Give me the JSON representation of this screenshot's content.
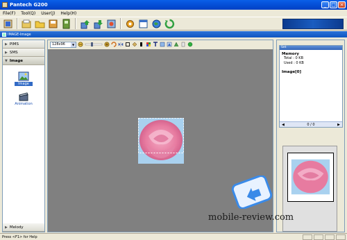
{
  "window": {
    "title": "Pantech G200"
  },
  "window_controls": [
    "minimize-icon",
    "maximize-icon",
    "close-icon"
  ],
  "menu": [
    {
      "label": "File(F)"
    },
    {
      "label": "Tool(Q)"
    },
    {
      "label": "User(J)"
    },
    {
      "label": "Help(H)"
    }
  ],
  "toolbar_icons": [
    "connect-icon",
    "folder-open-icon",
    "folder-icon",
    "save-icon",
    "phonebook-icon",
    "upload-icon",
    "download-icon",
    "sync-icon",
    "settings-icon",
    "calendar-icon",
    "globe-icon",
    "refresh-icon"
  ],
  "pathbar": {
    "label": "IMAGE-Image"
  },
  "sidebar": {
    "sections": [
      {
        "label": "PIMS"
      },
      {
        "label": "SMS"
      },
      {
        "label": "Image"
      }
    ],
    "items": [
      {
        "label": "Image",
        "selected": true
      },
      {
        "label": "Animation",
        "selected": false
      }
    ],
    "footer": {
      "label": "Melody"
    }
  },
  "canvas": {
    "size_select": "128x96",
    "tools": [
      "zoom-out-icon",
      "zoom-slider-icon",
      "zoom-in-icon",
      "rotate-icon",
      "flip-icon",
      "crop-icon",
      "fill-icon",
      "color-icon",
      "grid-icon",
      "text-icon",
      "resize-icon",
      "effect-icon",
      "copy-icon",
      "paste-icon",
      "apply-icon"
    ]
  },
  "memory": {
    "header": "Set",
    "title": "Memory",
    "total": "Total : 0 KB",
    "used": "Used : 0 KB",
    "list_label": "Image[0]",
    "page": "0 / 0"
  },
  "status": {
    "text": "Press <F1> for Help"
  },
  "watermark": {
    "text": "mobile-review.com"
  },
  "colors": {
    "title_bar": "#0550d8",
    "canvas": "#808080",
    "selection": "#316ac5"
  }
}
